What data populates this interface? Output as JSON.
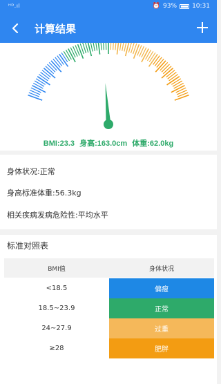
{
  "status_bar": {
    "signal": "ᴴᴰ.ıl",
    "alarm": "⏰",
    "battery_pct": "93%",
    "time": "10:31"
  },
  "header": {
    "title": "计算结果",
    "back_icon": "chevron-left-icon",
    "add_icon": "plus-icon"
  },
  "gauge": {
    "needle_fraction": 0.47,
    "colors": {
      "low": "#2f86f0",
      "normal": "#2eaa6a",
      "over": "#f2b54a",
      "obese": "#f39c12"
    },
    "bmi_text": "BMI:23.3",
    "height_text": "身高:163.0cm",
    "weight_text": "体重:62.0kg"
  },
  "info": {
    "condition": "身体状况:正常",
    "standard_weight": "身高标准体重:56.3kg",
    "risk": "相关疾病发病危险性:平均水平"
  },
  "table": {
    "title": "标准对照表",
    "headers": {
      "bmi": "BMI值",
      "status": "身体状况"
    },
    "rows": [
      {
        "range": "<18.5",
        "status": "偏瘦",
        "color": "#1e88e5"
      },
      {
        "range": "18.5~23.9",
        "status": "正常",
        "color": "#2eaa6a"
      },
      {
        "range": "24~27.9",
        "status": "过重",
        "color": "#f5b85a"
      },
      {
        "range": "≥28",
        "status": "肥胖",
        "color": "#f39c12"
      }
    ]
  }
}
